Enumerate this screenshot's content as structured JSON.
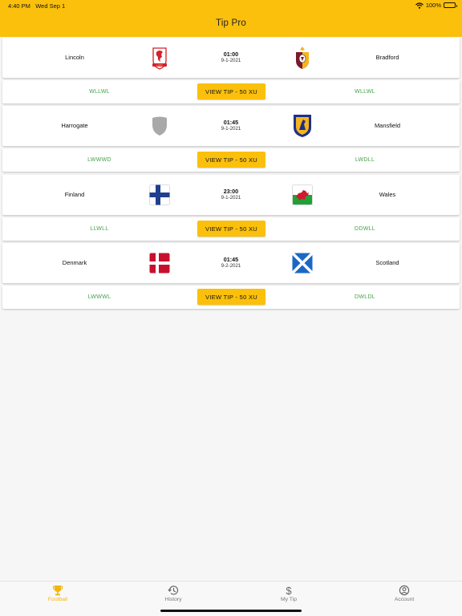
{
  "status_bar": {
    "time": "4:40 PM",
    "date": "Wed Sep 1",
    "battery": "100%"
  },
  "header": {
    "title": "Tip Pro"
  },
  "matches": [
    {
      "home": "Lincoln",
      "away": "Bradford",
      "home_logo": "lincoln-crest-icon",
      "away_logo": "bradford-crest-icon",
      "time": "01:00",
      "date": "9-1-2021",
      "home_form": "WLLWL",
      "away_form": "WLLWL",
      "tip_label": "VIEW TIP - 50 XU"
    },
    {
      "home": "Harrogate",
      "away": "Mansfield",
      "home_logo": "placeholder-shield-icon",
      "away_logo": "mansfield-crest-icon",
      "time": "01:45",
      "date": "9-1-2021",
      "home_form": "LWWWD",
      "away_form": "LWDLL",
      "tip_label": "VIEW TIP - 50 XU"
    },
    {
      "home": "Finland",
      "away": "Wales",
      "home_logo": "finland-flag-icon",
      "away_logo": "wales-flag-icon",
      "time": "23:00",
      "date": "9-1-2021",
      "home_form": "LLWLL",
      "away_form": "DDWLL",
      "tip_label": "VIEW TIP - 50 XU"
    },
    {
      "home": "Denmark",
      "away": "Scotland",
      "home_logo": "denmark-flag-icon",
      "away_logo": "scotland-flag-icon",
      "time": "01:45",
      "date": "9-2-2021",
      "home_form": "LWWWL",
      "away_form": "DWLDL",
      "tip_label": "VIEW TIP - 50 XU"
    }
  ],
  "tabbar": {
    "tabs": [
      {
        "label": "Football",
        "icon": "trophy-icon",
        "active": true
      },
      {
        "label": "History",
        "icon": "history-icon",
        "active": false
      },
      {
        "label": "My Tip",
        "icon": "dollar-icon",
        "active": false
      },
      {
        "label": "Account",
        "icon": "account-icon",
        "active": false
      }
    ]
  },
  "colors": {
    "accent": "#fbc00c",
    "form_text": "#46a04a",
    "active_tab": "#f3b50a"
  }
}
